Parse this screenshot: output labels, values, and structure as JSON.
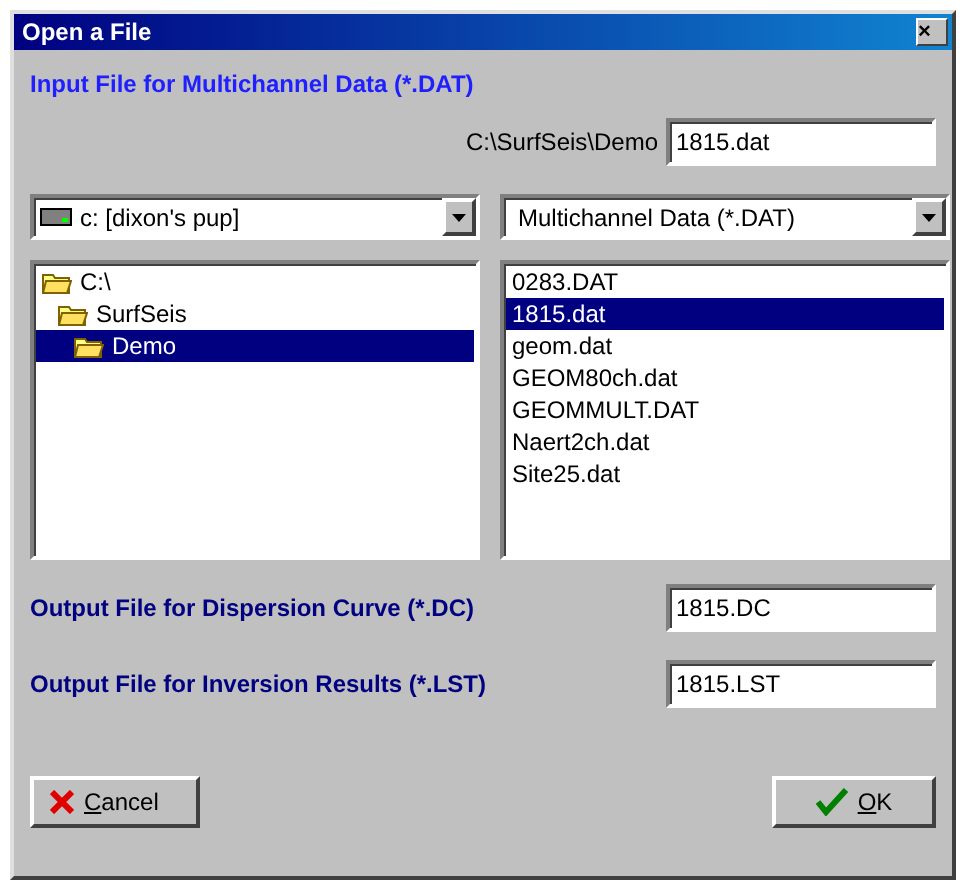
{
  "window": {
    "title": "Open a File",
    "close": "×"
  },
  "input_section": {
    "heading": "Input File for Multichannel Data (*.DAT)",
    "path": "C:\\SurfSeis\\Demo",
    "file_name": "1815.dat"
  },
  "drive_select": {
    "value": "c: [dixon's pup]"
  },
  "type_select": {
    "value": "Multichannel Data (*.DAT)"
  },
  "folders": [
    {
      "label": "C:\\",
      "selected": false,
      "children": [
        {
          "label": "SurfSeis",
          "selected": false,
          "children": [
            {
              "label": "Demo",
              "selected": true
            }
          ]
        }
      ]
    }
  ],
  "files": [
    {
      "label": "0283.DAT",
      "selected": false
    },
    {
      "label": "1815.dat",
      "selected": true
    },
    {
      "label": "geom.dat",
      "selected": false
    },
    {
      "label": "GEOM80ch.dat",
      "selected": false
    },
    {
      "label": "GEOMMULT.DAT",
      "selected": false
    },
    {
      "label": "Naert2ch.dat",
      "selected": false
    },
    {
      "label": "Site25.dat",
      "selected": false
    }
  ],
  "outputs": [
    {
      "label": "Output File for Dispersion Curve (*.DC)",
      "value": "1815.DC"
    },
    {
      "label": "Output File for Inversion Results (*.LST)",
      "value": "1815.LST"
    }
  ],
  "buttons": [
    {
      "kind": "cancel",
      "label": "Cancel"
    },
    {
      "kind": "ok",
      "label": "OK"
    }
  ]
}
